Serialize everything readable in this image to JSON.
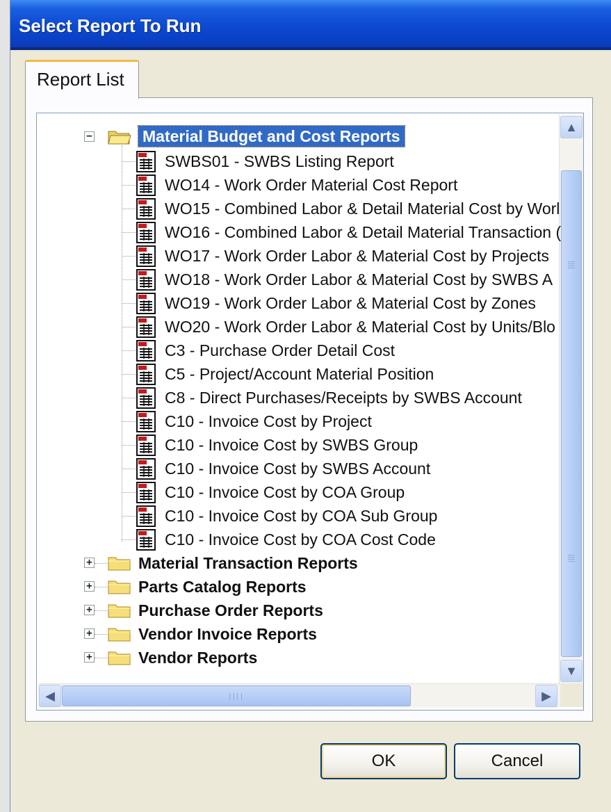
{
  "window": {
    "title": "Select Report To Run"
  },
  "tabs": [
    {
      "label": "Report List"
    }
  ],
  "tree": {
    "expanded_group": "Material Budget and Cost Reports",
    "reports": [
      "SWBS01 - SWBS Listing Report",
      "WO14 - Work Order Material Cost Report",
      "WO15 - Combined Labor & Detail Material Cost by Worl",
      "WO16 - Combined Labor & Detail Material Transaction (",
      "WO17 - Work Order Labor & Material Cost by Projects",
      "WO18 - Work Order Labor & Material Cost by SWBS A",
      "WO19 - Work Order Labor & Material Cost by Zones",
      "WO20 - Work Order Labor & Material Cost by Units/Blo",
      "C3 - Purchase Order Detail Cost",
      "C5 - Project/Account Material Position",
      "C8 - Direct Purchases/Receipts by SWBS Account",
      "C10 - Invoice Cost by Project",
      "C10 - Invoice Cost by SWBS Group",
      "C10 - Invoice Cost by SWBS Account",
      "C10 - Invoice Cost by COA Group",
      "C10 - Invoice Cost by COA Sub Group",
      "C10 - Invoice Cost by COA Cost Code"
    ],
    "collapsed_groups": [
      "Material Transaction Reports",
      "Parts Catalog Reports",
      "Purchase Order Reports",
      "Vendor Invoice Reports",
      "Vendor Reports"
    ],
    "icons": {
      "expanded": "folder-open-icon",
      "collapsed": "folder-closed-icon",
      "report": "report-document-icon"
    }
  },
  "buttons": {
    "ok": "OK",
    "cancel": "Cancel"
  },
  "colors": {
    "title_bar": "#0a40c4",
    "selection": "#316ac5",
    "dialog_bg": "#ece9d8"
  }
}
